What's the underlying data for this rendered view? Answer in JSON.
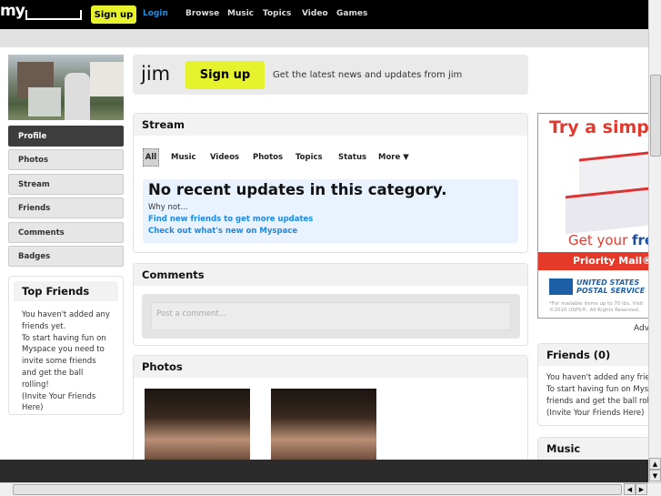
{
  "topbar": {
    "logo": "my",
    "signup": "Sign up",
    "login": "Login",
    "nav": [
      "Browse",
      "Music",
      "Topics",
      "Video",
      "Games"
    ]
  },
  "sidebar": {
    "items": [
      "Profile",
      "Photos",
      "Stream",
      "Friends",
      "Comments",
      "Badges"
    ],
    "top_friends": {
      "title": "Top Friends",
      "text": [
        "You haven't added any friends yet.",
        "To start having fun on Myspace you need to invite some friends and get the ball rolling!",
        "(Invite Your Friends Here)"
      ]
    }
  },
  "header": {
    "name": "jim",
    "signup": "Sign up",
    "text": "Get the latest news and updates from jim"
  },
  "stream": {
    "title": "Stream",
    "tabs": [
      "All",
      "Music",
      "Videos",
      "Photos",
      "Topics",
      "Status",
      "More ▼"
    ],
    "empty_title": "No recent updates in this category.",
    "why": "Why not...",
    "link1": "Find new friends to get more updates",
    "link2": "Check out what's new on Myspace"
  },
  "comments": {
    "title": "Comments",
    "placeholder": "Post a comment..."
  },
  "photos": {
    "title": "Photos"
  },
  "ad": {
    "headline": "Try a simple",
    "get": "Get your ",
    "free": "free",
    "bar": "Priority Mail®",
    "usps1": "UNITED STATES",
    "usps2": "POSTAL SERVICE ®",
    "fine1": "*For mailable items up to 70 lbs. Visit",
    "fine2": "©2010 USPS®. All Rights Reserved.",
    "label": "Adv"
  },
  "friends": {
    "title": "Friends (0)",
    "text": [
      "You haven't added any friends yet.",
      "To start having fun on Myspace invite some",
      "friends and get the ball rolling!",
      "(Invite Your Friends Here)"
    ]
  },
  "music": {
    "title": "Music"
  },
  "colors": {
    "accent": "#e6f22b",
    "link": "#1e88e5"
  }
}
